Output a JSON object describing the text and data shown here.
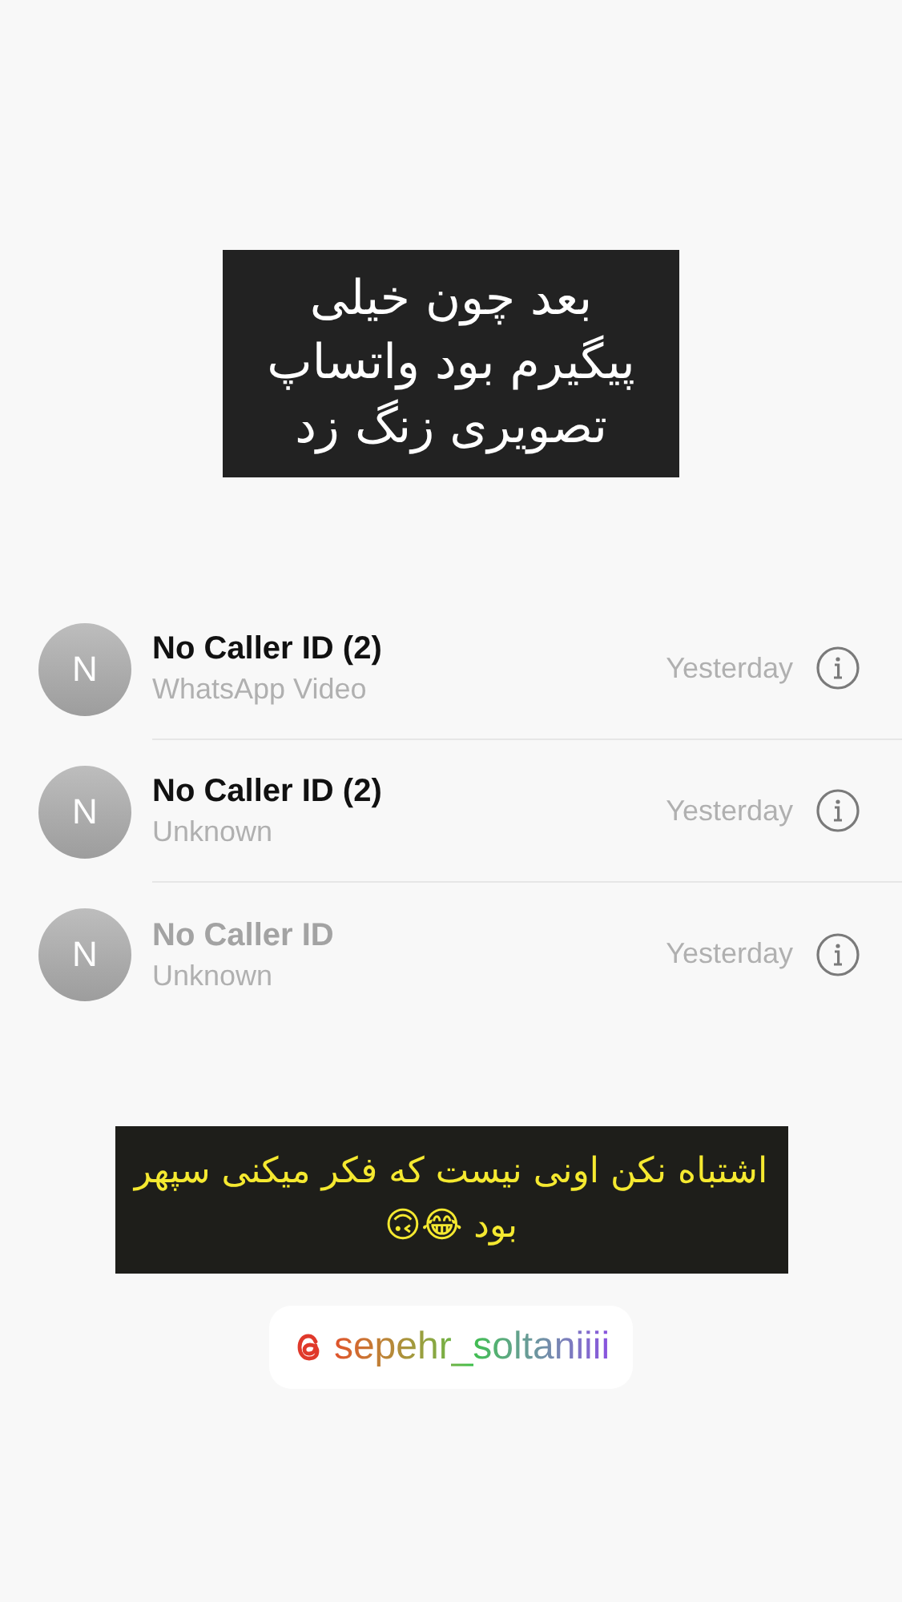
{
  "caption_top": "بعد چون خیلی پیگیرم بود واتساپ تصویری زنگ زد",
  "calls": [
    {
      "initial": "N",
      "name": "No Caller ID (2)",
      "detail": "WhatsApp Video",
      "time": "Yesterday",
      "dimmed": false
    },
    {
      "initial": "N",
      "name": "No Caller ID (2)",
      "detail": "Unknown",
      "time": "Yesterday",
      "dimmed": false
    },
    {
      "initial": "N",
      "name": "No Caller ID",
      "detail": "Unknown",
      "time": "Yesterday",
      "dimmed": true
    }
  ],
  "caption_bottom": "اشتباه نکن اونی نیست که فکر میکنی سپهر بود 😂🙃",
  "mention": "sepehr_soltaniiii"
}
